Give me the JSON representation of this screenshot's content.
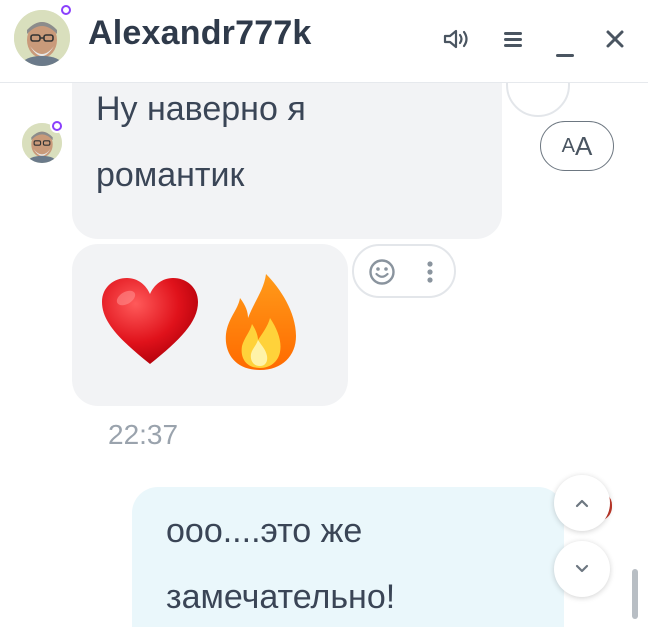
{
  "header": {
    "contact_name": "Alexandr777k",
    "avatar_icon": "user-avatar",
    "online_icon": "online-status-icon",
    "actions": [
      "sound-icon",
      "menu-icon",
      "minimize-icon",
      "close-icon"
    ],
    "minimize_glyph": "_",
    "close_glyph": "✕"
  },
  "messages": {
    "incoming_text": "Ну наверно я романтик",
    "incoming_line1": "Ну наверно я",
    "incoming_line2": "романтик",
    "emoji_message": "❤️🔥",
    "emoji_heart": "heart-emoji",
    "emoji_fire": "fire-emoji",
    "time": "22:37",
    "outgoing_line1": "ооо....это же",
    "outgoing_line2": "замечательно!"
  },
  "controls": {
    "font_size_label_small": "A",
    "font_size_label_big": "A",
    "scroll_up_icon": "chevron-up-icon",
    "scroll_down_icon": "chevron-down-icon",
    "reaction_icon": "smiley-icon",
    "more_icon": "more-vertical-icon"
  },
  "colors": {
    "accent_online": "#8a3ffc",
    "incoming_bubble": "#f2f3f5",
    "outgoing_bubble": "#eaf7fb",
    "text": "#3a4556"
  }
}
